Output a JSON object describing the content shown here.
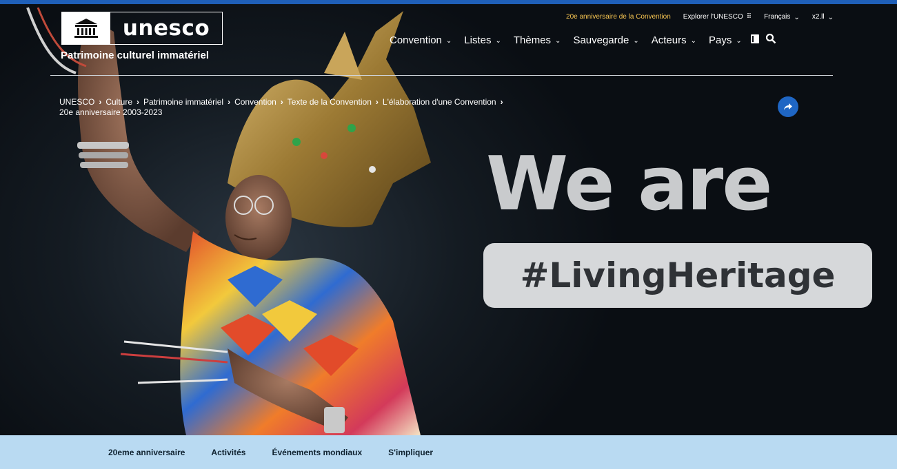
{
  "header": {
    "logo_word": "unesco",
    "subtitle": "Patrimoine culturel immatériel"
  },
  "utility_nav": {
    "anniversary_link": "20e anniversaire de la Convention",
    "explore_link": "Explorer l'UNESCO",
    "language": "Français",
    "extra": "x2.ll"
  },
  "main_nav": {
    "items": [
      {
        "label": "Convention"
      },
      {
        "label": "Listes"
      },
      {
        "label": "Thèmes"
      },
      {
        "label": "Sauvegarde"
      },
      {
        "label": "Acteurs"
      },
      {
        "label": "Pays"
      }
    ]
  },
  "breadcrumb": {
    "items": [
      "UNESCO",
      "Culture",
      "Patrimoine immatériel",
      "Convention",
      "Texte de la Convention",
      "L'élaboration d'une Convention",
      "20e anniversaire 2003-2023"
    ]
  },
  "hero": {
    "headline": "We are",
    "hashtag": "#LivingHeritage"
  },
  "subnav": {
    "items": [
      "20eme anniversaire",
      "Activités",
      "Événements mondiaux",
      "S'impliquer"
    ]
  },
  "colors": {
    "accent_blue": "#1f66c4",
    "anniversary_gold": "#f5c451",
    "subnav_bg": "#b9daf2"
  }
}
